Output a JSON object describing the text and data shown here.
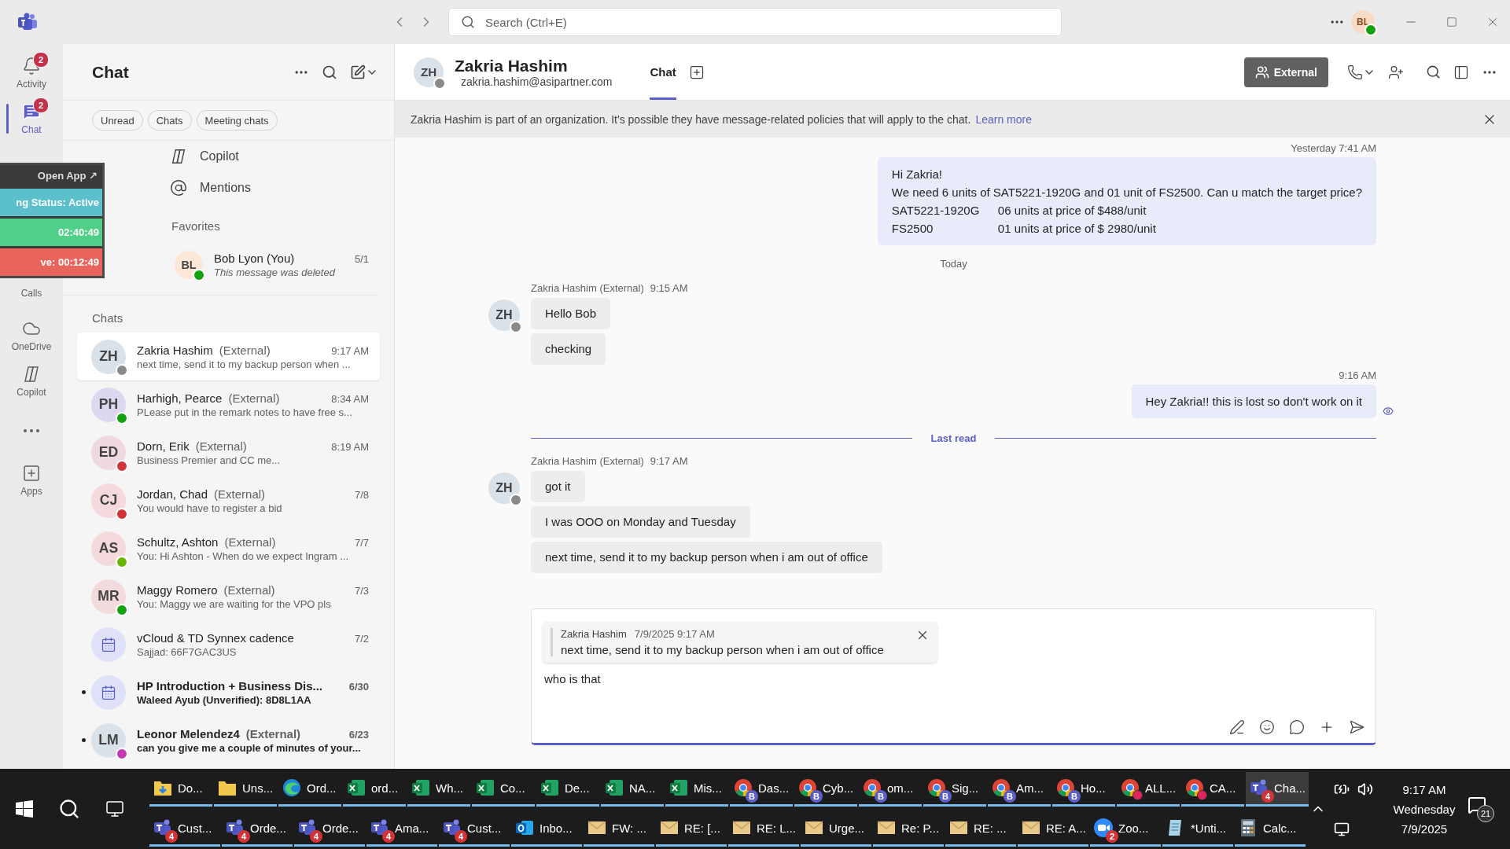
{
  "titlebar": {
    "search_placeholder": "Search (Ctrl+E)",
    "user_initials": "BL",
    "user_status": {
      "color": "#13a10e"
    }
  },
  "rail": [
    {
      "label": "Activity",
      "badge": "2",
      "selected": false
    },
    {
      "label": "Chat",
      "badge": "2",
      "selected": true
    },
    {
      "label": "Calls",
      "selected": false
    },
    {
      "label": "OneDrive",
      "selected": false
    },
    {
      "label": "Copilot",
      "selected": false
    },
    {
      "selected": false
    },
    {
      "label": "Apps",
      "selected": false
    }
  ],
  "overlay": {
    "open_app": "Open App ↗",
    "rows": [
      {
        "text": "ng Status: Active",
        "color": "#5bbfcc"
      },
      {
        "text": "02:40:49",
        "color": "#4fcf87"
      },
      {
        "text": "ve: 00:12:49",
        "color": "#e8645c"
      }
    ]
  },
  "chat_panel": {
    "title": "Chat",
    "filters": [
      {
        "label": "Unread",
        "selected": false
      },
      {
        "label": "Chats",
        "selected": false
      },
      {
        "label": "Meeting chats",
        "selected": false
      }
    ],
    "shortcuts": [
      {
        "label": "Copilot"
      },
      {
        "label": "Mentions"
      }
    ],
    "favorites_label": "Favorites",
    "favorites": [
      {
        "avatar": {
          "initials": "BL",
          "color": "#fde7d9"
        },
        "status": {
          "color": "#13a10e"
        },
        "name": "Bob Lyon (You)",
        "time": "5/1",
        "preview": "This message was deleted",
        "deleted": true
      }
    ],
    "chats_label": "Chats",
    "chats": [
      {
        "kind": "person",
        "avatar": {
          "initials": "ZH",
          "color": "#d9e2e8"
        },
        "status": {
          "color": "#8a8a8a"
        },
        "name": "Zakria Hashim",
        "tag": "(External)",
        "time": "9:17 AM",
        "preview": "next time, send it to my backup person when ...",
        "unread": false,
        "selected": true
      },
      {
        "kind": "person",
        "avatar": {
          "initials": "PH",
          "color": "#dcd8f0"
        },
        "status": {
          "color": "#13a10e"
        },
        "name": "Harhigh, Pearce",
        "tag": "(External)",
        "time": "8:34 AM",
        "preview": "PLease put in the remark notes to have free s...",
        "unread": false,
        "selected": false
      },
      {
        "kind": "person",
        "avatar": {
          "initials": "ED",
          "color": "#f0d8e2"
        },
        "status": {
          "color": "#d13438"
        },
        "name": "Dorn, Erik",
        "tag": "(External)",
        "time": "8:19 AM",
        "preview": "Business Premier and CC me...",
        "unread": false,
        "selected": false
      },
      {
        "kind": "person",
        "avatar": {
          "initials": "CJ",
          "color": "#f4dadd"
        },
        "status": {
          "color": "#d13438"
        },
        "name": "Jordan, Chad",
        "tag": "(External)",
        "time": "7/8",
        "preview": "You would have to register a bid",
        "unread": false,
        "selected": false
      },
      {
        "kind": "person",
        "avatar": {
          "initials": "AS",
          "color": "#f4dadd"
        },
        "status": {
          "color": "#6bb700"
        },
        "name": "Schultz, Ashton",
        "tag": "(External)",
        "time": "7/7",
        "preview": "You: Hi Ashton -  When do we expect Ingram ...",
        "unread": false,
        "selected": false
      },
      {
        "kind": "person",
        "avatar": {
          "initials": "MR",
          "color": "#f2dadd"
        },
        "status": {
          "color": "#13a10e"
        },
        "name": "Maggy Romero",
        "tag": "(External)",
        "time": "7/3",
        "preview": "You: Maggy we are waiting for the VPO pls",
        "unread": false,
        "selected": false
      },
      {
        "kind": "meeting",
        "name": "vCloud & TD Synnex cadence",
        "time": "7/2",
        "preview": "Sajjad: 66F7GAC3US",
        "unread": false,
        "selected": false
      },
      {
        "kind": "meeting",
        "name": "HP Introduction + Business Dis...",
        "time": "6/30",
        "preview": "Waleed Ayub (Unverified): 8D8L1AA",
        "unread": true,
        "selected": false
      },
      {
        "kind": "person",
        "avatar": {
          "initials": "LM",
          "color": "#d9e2e8"
        },
        "status": {
          "color": "#c239b3"
        },
        "name": "Leonor Melendez4",
        "tag": "(External)",
        "time": "6/23",
        "preview": "can you give me a couple of minutes of your...",
        "unread": true,
        "selected": false
      }
    ]
  },
  "conversation": {
    "contact": {
      "initials": "ZH",
      "status": {
        "color": "#8a8a8a"
      },
      "name": "Zakria Hashim",
      "email": "zakria.hashim@asipartner.com"
    },
    "tabs": [
      {
        "label": "Chat",
        "selected": true
      }
    ],
    "external_label": "External",
    "banner": {
      "text": "Zakria Hashim is part of an organization. It's possible they have message-related policies that will apply to the chat.",
      "link": "Learn more"
    },
    "messages": [
      {
        "kind": "outgoing",
        "time": "Yesterday 7:41 AM",
        "seen": false,
        "lines": [
          [
            "Hi Zakria!"
          ],
          [
            "We need 6 units of SAT5221-1920G and 01 unit of FS2500. Can u match the target price?"
          ],
          [
            "SAT5221-1920G",
            "06 units at price of $488/unit"
          ],
          [
            "FS2500",
            "01 units at price of $ 2980/unit"
          ]
        ]
      },
      {
        "kind": "day",
        "label": "Today"
      },
      {
        "kind": "incoming",
        "sender": "Zakria Hashim (External)",
        "time": "9:15 AM",
        "initials": "ZH",
        "status": {
          "color": "#8a8a8a"
        },
        "bubbles": [
          "Hello Bob",
          "checking"
        ]
      },
      {
        "kind": "outgoing",
        "time": "9:16 AM",
        "seen": true,
        "lines": [
          [
            "Hey Zakria!! this is lost so don't work on it"
          ]
        ]
      },
      {
        "kind": "read_marker",
        "label": "Last read"
      },
      {
        "kind": "incoming",
        "sender": "Zakria Hashim (External)",
        "time": "9:17 AM",
        "initials": "ZH",
        "status": {
          "color": "#8a8a8a"
        },
        "bubbles": [
          "got it",
          "I was OOO on Monday and Tuesday",
          "next time, send it to my backup person when i am out of office"
        ]
      }
    ],
    "compose": {
      "quote": {
        "author": "Zakria Hashim",
        "time": "7/9/2025 9:17 AM",
        "text": "next time, send it to my backup person when i am out of office"
      },
      "value": "who is that"
    }
  },
  "taskbar": {
    "top_row": [
      {
        "kind": "downloads",
        "label": "Do...",
        "selected": false
      },
      {
        "kind": "folder",
        "label": "Uns...",
        "selected": false
      },
      {
        "kind": "edge",
        "label": "Ord...",
        "selected": false
      },
      {
        "kind": "excel",
        "label": "ord...",
        "selected": false
      },
      {
        "kind": "excel",
        "label": "Wh...",
        "selected": false
      },
      {
        "kind": "excel",
        "label": "Co...",
        "selected": false
      },
      {
        "kind": "excel",
        "label": "De...",
        "selected": false
      },
      {
        "kind": "excel",
        "label": "NA...",
        "selected": false
      },
      {
        "kind": "excel",
        "label": "Mis...",
        "selected": false
      },
      {
        "kind": "chrome",
        "badge": "B",
        "label": "Das...",
        "selected": false
      },
      {
        "kind": "chrome",
        "badge": "B",
        "label": "Cyb...",
        "selected": false
      },
      {
        "kind": "chrome",
        "badge": "B",
        "label": "om...",
        "selected": false
      },
      {
        "kind": "chrome",
        "badge": "B",
        "label": "Sig...",
        "selected": false
      },
      {
        "kind": "chrome",
        "badge": "B",
        "label": "Am...",
        "selected": false
      },
      {
        "kind": "chrome",
        "badge": "B",
        "label": "Ho...",
        "selected": false
      },
      {
        "kind": "chrome",
        "color": "#e0245e",
        "label": "ALL...",
        "selected": false
      },
      {
        "kind": "chrome",
        "color": "#e0245e",
        "label": "CA...",
        "selected": false
      },
      {
        "kind": "teams",
        "badge": "4",
        "label": "Cha...",
        "selected": true
      }
    ],
    "bottom_row": [
      {
        "kind": "teams",
        "badge": "4",
        "label": "Cust...",
        "selected": false
      },
      {
        "kind": "teams",
        "badge": "4",
        "label": "Orde...",
        "selected": false
      },
      {
        "kind": "teams",
        "badge": "4",
        "label": "Orde...",
        "selected": false
      },
      {
        "kind": "teams",
        "badge": "4",
        "label": "Ama...",
        "selected": false
      },
      {
        "kind": "teams",
        "badge": "4",
        "label": "Cust...",
        "selected": false
      },
      {
        "kind": "outlook",
        "label": "Inbo...",
        "selected": false
      },
      {
        "kind": "mail",
        "label": "FW: ...",
        "selected": false
      },
      {
        "kind": "mail",
        "label": "RE: [...",
        "selected": false
      },
      {
        "kind": "mail",
        "label": "RE: L...",
        "selected": false
      },
      {
        "kind": "mail",
        "label": "Urge...",
        "selected": false
      },
      {
        "kind": "mail",
        "label": "Re: P...",
        "selected": false
      },
      {
        "kind": "mail",
        "label": "RE: ...",
        "selected": false
      },
      {
        "kind": "mail",
        "label": "RE: A...",
        "selected": false
      },
      {
        "kind": "zoom",
        "badge": "2",
        "label": "Zoo...",
        "selected": false
      },
      {
        "kind": "notepad",
        "label": "*Unti...",
        "selected": false
      },
      {
        "kind": "calc",
        "label": "Calc...",
        "selected": false
      }
    ],
    "tray": {
      "time": "9:17 AM",
      "day": "Wednesday",
      "date": "7/9/2025",
      "notifications": "21"
    }
  }
}
